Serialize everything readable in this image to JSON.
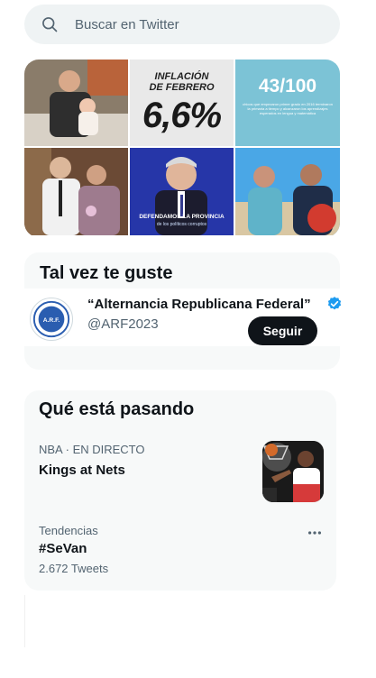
{
  "search": {
    "placeholder": "Buscar en Twitter",
    "icon": "search-icon"
  },
  "media": {
    "tile2_top": "INFLACIÓN\nDE FEBRERO",
    "tile2_value": "6,6%",
    "tile3_value": "43/100",
    "tile3_text": "chicos que empezaron primer grado en 2016 terminaron la primaria a tiempo y alcanzaron los aprendizajes esperados en lengua y matemática",
    "tile5_caption": "DEFENDAMOS LA PROVINCIA",
    "tile5_sub": "de los políticos corruptos"
  },
  "who_to_follow": {
    "title": "Tal vez te guste",
    "account": {
      "name": "“Alternancia Republicana Federal”",
      "handle": "@ARF2023",
      "avatar_text": "A.R.F.",
      "follow_label": "Seguir",
      "verified_color": "#1d9bf0"
    }
  },
  "trends": {
    "title": "Qué está pasando",
    "items": [
      {
        "context": "NBA · EN DIRECTO",
        "title": "Kings at Nets"
      },
      {
        "context": "Tendencias",
        "title": "#SeVan",
        "count": "2.672 Tweets"
      }
    ]
  },
  "colors": {
    "text_primary": "#0f1419",
    "text_secondary": "#536471",
    "card_bg": "#f7f9f9",
    "search_bg": "#eff3f4",
    "button_bg": "#0f1419"
  }
}
